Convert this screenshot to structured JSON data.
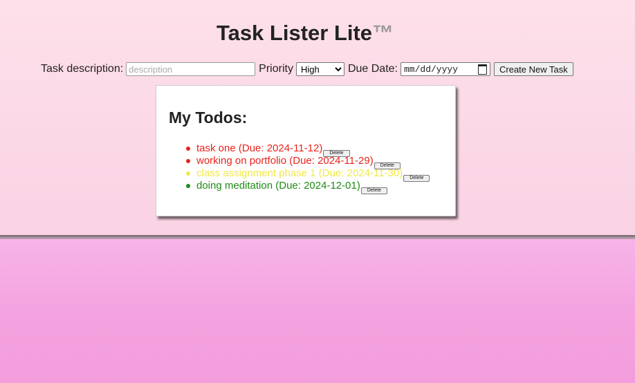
{
  "header": {
    "title": "Task Lister Lite",
    "trademark": "™"
  },
  "form": {
    "description_label": "Task description:",
    "description_placeholder": "description",
    "description_value": "",
    "priority_label": "Priority",
    "priority_selected": "High",
    "priority_options": [
      "High"
    ],
    "due_date_label": "Due Date:",
    "due_date_placeholder": "mm/dd/yyyy",
    "submit_label": "Create New Task"
  },
  "todos": {
    "heading": "My Todos:",
    "delete_label": "Delete",
    "items": [
      {
        "text": "task one (Due: 2024-11-12)",
        "color": "#e8231c"
      },
      {
        "text": "working on portfolio (Due: 2024-11-29)",
        "color": "#e8231c"
      },
      {
        "text": "class assignment phase 1 (Due: 2024-11-30)",
        "color": "#f0e84a"
      },
      {
        "text": "doing meditation (Due: 2024-12-01)",
        "color": "#1f8a17"
      }
    ]
  },
  "colors": {
    "high_priority": "#e8231c",
    "medium_priority": "#f0e84a",
    "low_priority": "#1f8a17"
  }
}
